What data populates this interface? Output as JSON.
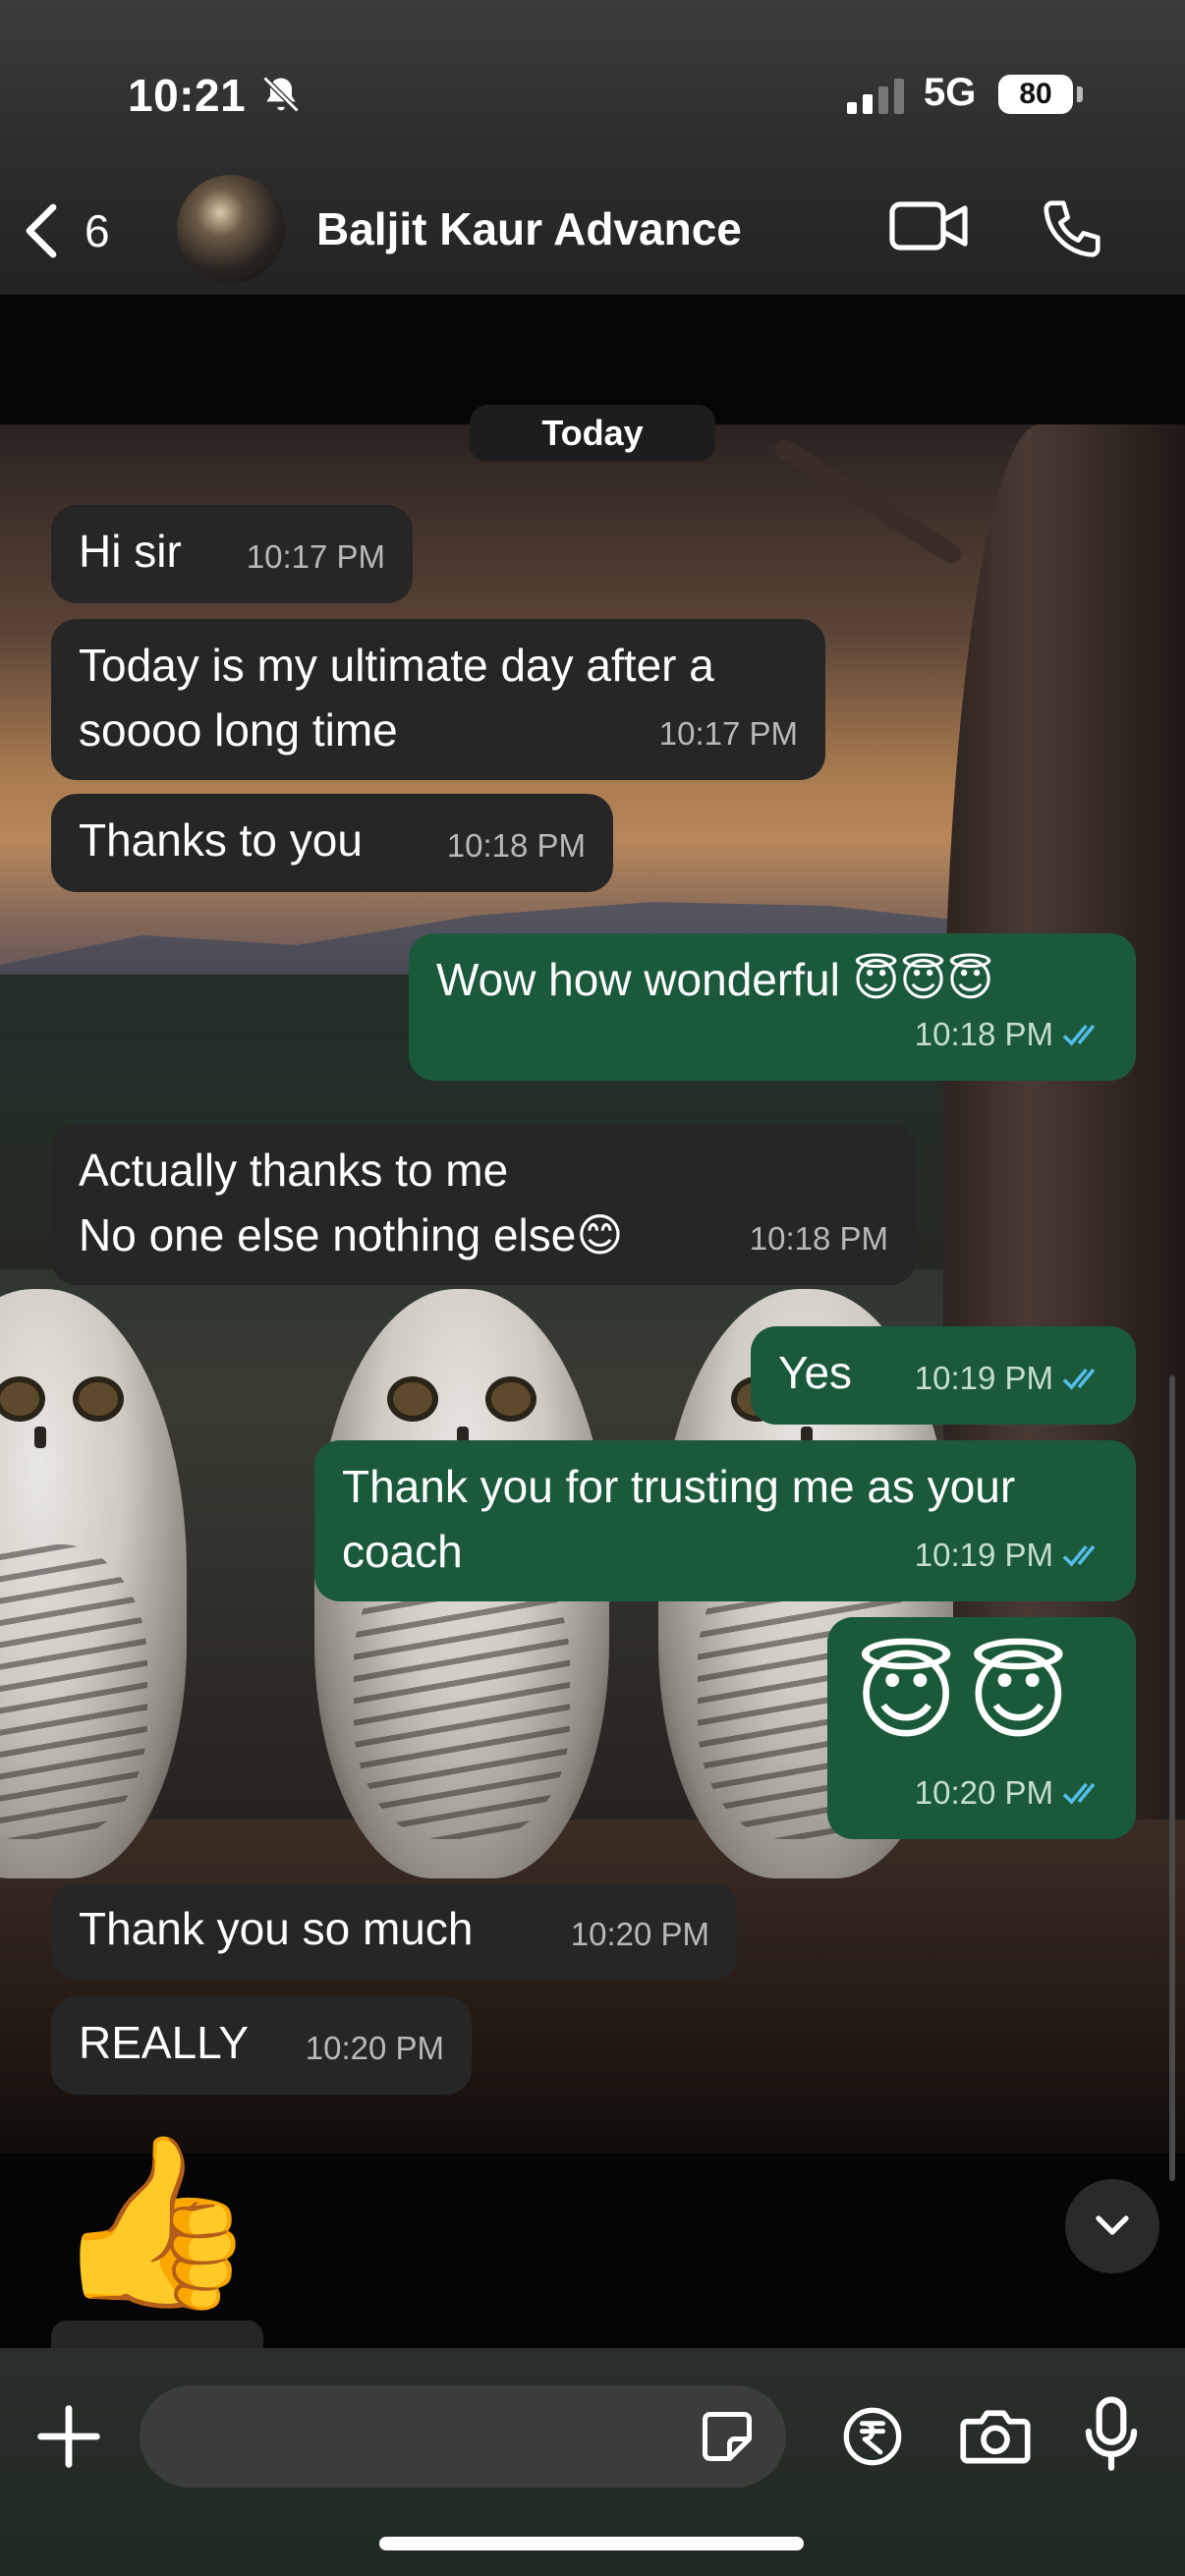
{
  "status_bar": {
    "time": "10:21",
    "network": "5G",
    "battery": "80"
  },
  "header": {
    "back_count": "6",
    "contact_name": "Baljit Kaur Advance"
  },
  "date_divider": "Today",
  "messages": [
    {
      "dir": "in",
      "text": "Hi sir",
      "time": "10:17 PM"
    },
    {
      "dir": "in",
      "text": "Today is my ultimate day after a\nsoooo long time",
      "time": "10:17 PM"
    },
    {
      "dir": "in",
      "text": "Thanks to you",
      "time": "10:18 PM"
    },
    {
      "dir": "out",
      "text": "Wow how wonderful 😇😇😇",
      "time": "10:18 PM"
    },
    {
      "dir": "in",
      "text": "Actually thanks to me\nNo one else nothing else😊",
      "time": "10:18 PM"
    },
    {
      "dir": "out",
      "text": "Yes",
      "time": "10:19 PM"
    },
    {
      "dir": "out",
      "text": "Thank you for trusting me as your\ncoach",
      "time": "10:19 PM"
    },
    {
      "dir": "out",
      "text": "😇😇",
      "time": "10:20 PM"
    },
    {
      "dir": "in",
      "text": "Thank you so much",
      "time": "10:20 PM"
    },
    {
      "dir": "in",
      "text": "REALLY",
      "time": "10:20 PM"
    }
  ],
  "reaction_emoji": "👍",
  "composer": {
    "placeholder": ""
  },
  "colors": {
    "incoming_bubble": "#262626",
    "outgoing_bubble": "#1a5a3a",
    "read_ticks": "#53bdeb"
  },
  "icons": [
    "chevron-left-icon",
    "video-icon",
    "phone-icon",
    "plus-icon",
    "sticker-icon",
    "rupee-icon",
    "camera-icon",
    "mic-icon",
    "chevron-down-icon"
  ]
}
